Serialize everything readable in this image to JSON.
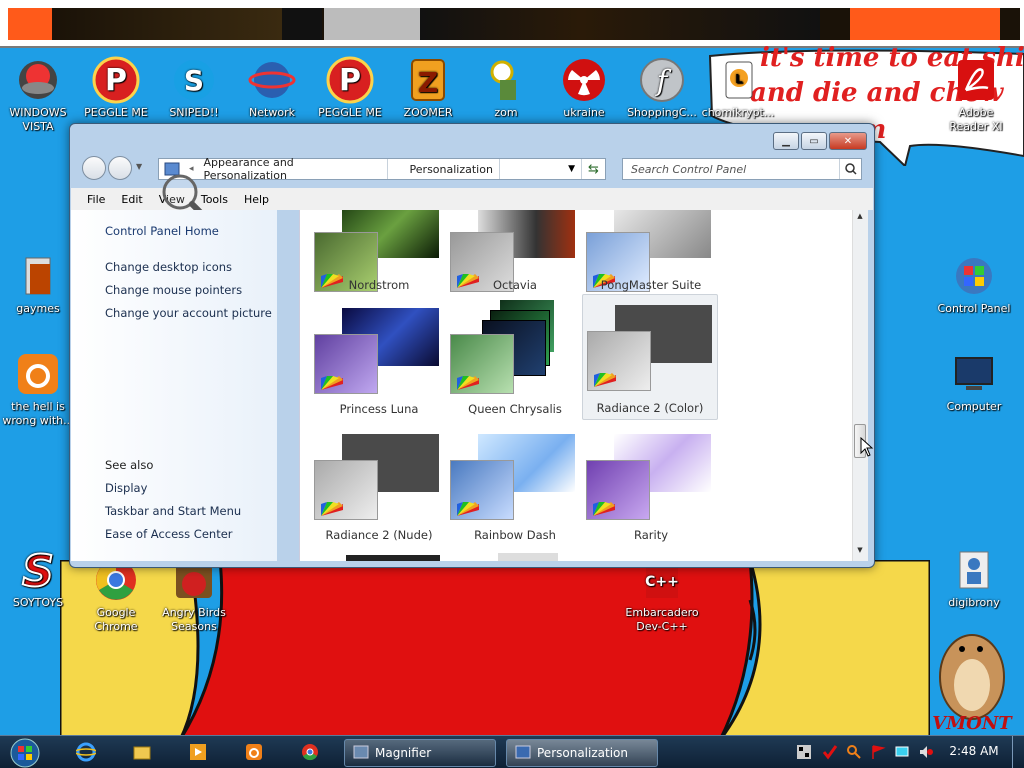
{
  "desktop": {
    "icons_top": [
      {
        "label": "WINDOWS VISTA",
        "icon": "vista-orb-icon"
      },
      {
        "label": "PEGGLE ME",
        "icon": "peggle-icon"
      },
      {
        "label": "SNIPED!!",
        "icon": "skype-icon"
      },
      {
        "label": "Network",
        "icon": "network-globe-icon"
      },
      {
        "label": "PEGGLE ME",
        "icon": "peggle-icon"
      },
      {
        "label": "ZOOMER",
        "icon": "zoomer-icon"
      },
      {
        "label": "zom",
        "icon": "zombie-icon"
      },
      {
        "label": "ukraine",
        "icon": "radiation-icon"
      },
      {
        "label": "ShoppingC...",
        "icon": "flash-icon"
      },
      {
        "label": "chomikrypt...",
        "icon": "chomik-icon"
      },
      {
        "label": "Adobe Reader XI",
        "icon": "adobe-reader-icon"
      }
    ],
    "icons_left": [
      {
        "label": "gaymes",
        "icon": "folder-icon"
      },
      {
        "label": "the hell is wrong with...",
        "icon": "uc-browser-icon"
      },
      {
        "label": "SOYTOYS",
        "icon": "s-logo-icon"
      },
      {
        "label": "Google Chrome",
        "icon": "chrome-icon"
      },
      {
        "label": "Angry Birds Seasons",
        "icon": "angry-birds-icon"
      },
      {
        "label": "Embarcadero Dev-C++",
        "icon": "devcpp-icon"
      }
    ],
    "icons_right": [
      {
        "label": "Control Panel",
        "icon": "control-panel-icon"
      },
      {
        "label": "Computer",
        "icon": "computer-icon"
      },
      {
        "label": "digibrony",
        "icon": "user-folder-icon"
      }
    ],
    "wallpaper_text": "it's time to eat shit and die and chew gum",
    "wallpaper_signature": "VMONT"
  },
  "window": {
    "address": {
      "crumbs": [
        "Appearance and Personalization",
        "Personalization"
      ]
    },
    "search_placeholder": "Search Control Panel",
    "menu": [
      "File",
      "Edit",
      "View",
      "Tools",
      "Help"
    ],
    "left_pane": {
      "home": "Control Panel Home",
      "links": [
        "Change desktop icons",
        "Change mouse pointers",
        "Change your account picture"
      ],
      "see_also_heading": "See also",
      "see_also": [
        "Display",
        "Taskbar and Start Menu",
        "Ease of Access Center"
      ]
    },
    "themes": [
      {
        "name": "Nordstrom",
        "selected": false
      },
      {
        "name": "Octavia",
        "selected": false
      },
      {
        "name": "PongMaster Suite",
        "selected": false
      },
      {
        "name": "Princess Luna",
        "selected": false
      },
      {
        "name": "Queen Chrysalis",
        "selected": false
      },
      {
        "name": "Radiance 2 (Color)",
        "selected": true
      },
      {
        "name": "Radiance 2 (Nude)",
        "selected": false
      },
      {
        "name": "Rainbow Dash",
        "selected": false
      },
      {
        "name": "Rarity",
        "selected": false
      }
    ]
  },
  "taskbar": {
    "buttons": [
      {
        "label": "Magnifier",
        "icon": "magnifier-icon"
      },
      {
        "label": "Personalization",
        "icon": "personalization-icon"
      }
    ],
    "clock": "2:48 AM"
  },
  "colors": {
    "desktop": "#1e9ee6",
    "wallpaper_red": "#e01010",
    "wallpaper_yellow": "#f5d84a"
  }
}
